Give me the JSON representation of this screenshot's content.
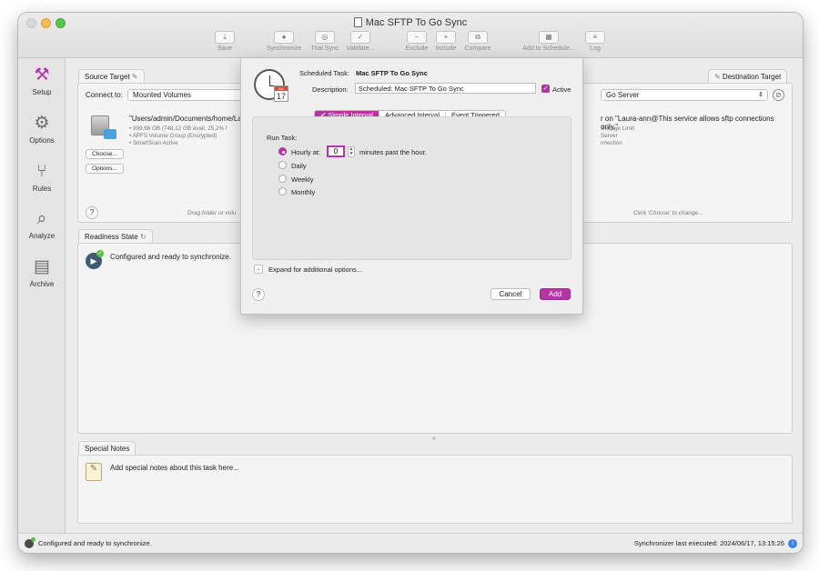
{
  "window": {
    "title": "Mac SFTP To Go Sync"
  },
  "toolbar": {
    "save": "Save",
    "synchronize": "Synchronize",
    "trial_sync": "Trial Sync",
    "validate": "Validate...",
    "exclude": "Exclude",
    "include": "Include",
    "compare": "Compare",
    "add_to_schedule": "Add to Schedule...",
    "log": "Log"
  },
  "sidebar": {
    "items": [
      {
        "label": "Setup",
        "icon": "wrench-icon"
      },
      {
        "label": "Options",
        "icon": "gear-icon"
      },
      {
        "label": "Rules",
        "icon": "rules-icon"
      },
      {
        "label": "Analyze",
        "icon": "analyze-icon"
      },
      {
        "label": "Archive",
        "icon": "archive-icon"
      }
    ]
  },
  "source": {
    "tab": "Source Target",
    "connect_label": "Connect to:",
    "connect_value": "Mounted Volumes",
    "path": "\"Users/admin/Documents/home/La",
    "details": [
      "• 999,66 GB (748,12 GB avail, 25,2% f",
      "• APFS Volume Group (Encrypted)",
      "• SmartScan Active"
    ],
    "choose": "Choose...",
    "options": "Options...",
    "hint": "Drag folder or volu"
  },
  "destination": {
    "tab": "Destination Target",
    "connect_value": "Go Server",
    "description": "r on \"Laura-ann@This service allows sftp connections only.\"",
    "details": [
      "Storage Limit",
      "Server",
      "nnection"
    ],
    "hint": "Click 'Choose' to change..."
  },
  "readiness": {
    "tab": "Readiness State",
    "message": "Configured and ready to synchronize."
  },
  "notes": {
    "tab": "Special Notes",
    "placeholder": "Add special notes about this task here..."
  },
  "status": {
    "left": "Configured and ready to synchronize.",
    "right": "Synchronizer last executed:  2024/06/17, 13:15:26"
  },
  "sheet": {
    "task_label": "Scheduled Task:",
    "task_name": "Mac SFTP To Go Sync",
    "description_label": "Description:",
    "description_value": "Scheduled: Mac SFTP To Go Sync",
    "active_label": "Active",
    "calendar_day": "17",
    "calendar_month": "JUL",
    "tabs": [
      "✔ Simple Interval",
      "Advanced Interval",
      "Event Triggered"
    ],
    "run_task_label": "Run Task:",
    "hourly_label": "Hourly at:",
    "minutes_value": "0",
    "minutes_suffix": "minutes past the hour.",
    "daily": "Daily",
    "weekly": "Weekly",
    "monthly": "Monthly",
    "expand_label": "Expand for additional options...",
    "cancel": "Cancel",
    "add": "Add"
  },
  "colors": {
    "accent": "#b336a4",
    "active_green": "#58c043"
  }
}
